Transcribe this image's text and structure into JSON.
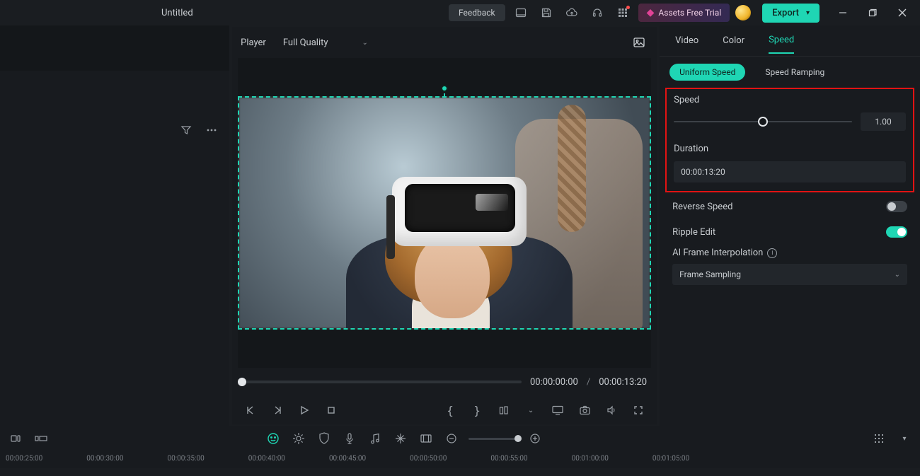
{
  "titlebar": {
    "project_title": "Untitled",
    "feedback_label": "Feedback",
    "assets_trial_label": "Assets Free Trial",
    "export_label": "Export"
  },
  "player": {
    "header_label": "Player",
    "quality_label": "Full Quality",
    "current_time": "00:00:00:00",
    "separator": "/",
    "total_time": "00:00:13:20"
  },
  "tabs": {
    "video": "Video",
    "color": "Color",
    "speed": "Speed"
  },
  "speed_panel": {
    "uniform_label": "Uniform Speed",
    "ramping_label": "Speed Ramping",
    "speed_label": "Speed",
    "speed_value": "1.00",
    "duration_label": "Duration",
    "duration_value": "00:00:13:20",
    "reverse_label": "Reverse Speed",
    "ripple_label": "Ripple Edit",
    "ai_label": "AI Frame Interpolation",
    "ai_option": "Frame Sampling"
  },
  "timeline": {
    "marks": [
      "00:00:25:00",
      "00:00:30:00",
      "00:00:35:00",
      "00:00:40:00",
      "00:00:45:00",
      "00:00:50:00",
      "00:00:55:00",
      "00:01:00:00",
      "00:01:05:00"
    ]
  }
}
